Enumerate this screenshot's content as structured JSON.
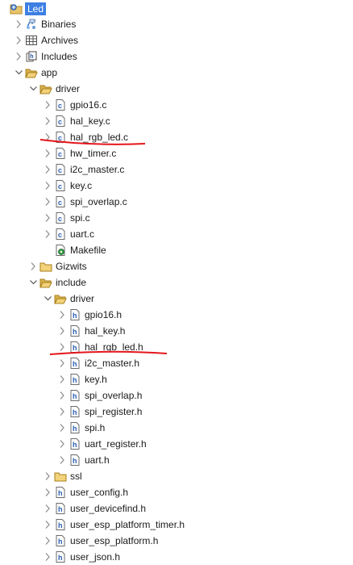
{
  "tree": {
    "project": "Led",
    "binaries": "Binaries",
    "archives": "Archives",
    "includes": "Includes",
    "app": "app",
    "driver": "driver",
    "driver_files": [
      "gpio16.c",
      "hal_key.c",
      "hal_rgb_led.c",
      "hw_timer.c",
      "i2c_master.c",
      "key.c",
      "spi_overlap.c",
      "spi.c",
      "uart.c"
    ],
    "makefile": "Makefile",
    "gizwits": "Gizwits",
    "include": "include",
    "include_driver": "driver",
    "include_driver_files": [
      "gpio16.h",
      "hal_key.h",
      "hal_rgb_led.h",
      "i2c_master.h",
      "key.h",
      "spi_overlap.h",
      "spi_register.h",
      "spi.h",
      "uart_register.h",
      "uart.h"
    ],
    "ssl": "ssl",
    "include_files": [
      "user_config.h",
      "user_devicefind.h",
      "user_esp_platform_timer.h",
      "user_esp_platform.h",
      "user_json.h"
    ]
  },
  "colors": {
    "selection": "#3d7fe3",
    "annotation": "#e4161b",
    "folder": "#e8c56a",
    "twisty": "#8a8a8a"
  }
}
